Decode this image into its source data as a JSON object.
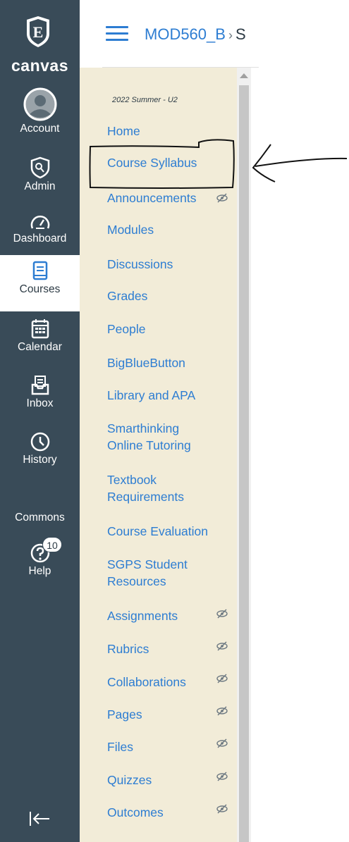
{
  "global_nav": {
    "logo_text": "canvas",
    "logo_letter": "E",
    "items": [
      {
        "label": "Account",
        "icon": "user-avatar-icon"
      },
      {
        "label": "Admin",
        "icon": "shield-icon"
      },
      {
        "label": "Dashboard",
        "icon": "speedometer-icon"
      },
      {
        "label": "Courses",
        "icon": "book-icon",
        "active": true
      },
      {
        "label": "Calendar",
        "icon": "calendar-icon"
      },
      {
        "label": "Inbox",
        "icon": "inbox-icon"
      },
      {
        "label": "History",
        "icon": "clock-icon"
      },
      {
        "label": "Commons",
        "icon": ""
      },
      {
        "label": "Help",
        "icon": "help-icon",
        "badge": "10"
      }
    ],
    "collapse_icon": "collapse-arrow-icon"
  },
  "header": {
    "course_code": "MOD560_B",
    "separator": "›",
    "next_crumb": "S"
  },
  "course_nav": {
    "term": "2022 Summer - U2",
    "items": [
      {
        "label": "Home"
      },
      {
        "label": "Course Syllabus"
      },
      {
        "label": "Announcements",
        "hidden": true
      },
      {
        "label": "Modules"
      },
      {
        "label": "Discussions"
      },
      {
        "label": "Grades"
      },
      {
        "label": "People"
      },
      {
        "label": "BigBlueButton"
      },
      {
        "label": "Library and APA"
      },
      {
        "label": "Smarthinking",
        "label2": "Online Tutoring"
      },
      {
        "label": "Textbook",
        "label2": "Requirements"
      },
      {
        "label": "Course Evaluation"
      },
      {
        "label": "SGPS Student",
        "label2": "Resources"
      },
      {
        "label": "Assignments",
        "hidden": true
      },
      {
        "label": "Rubrics",
        "hidden": true
      },
      {
        "label": "Collaborations",
        "hidden": true
      },
      {
        "label": "Pages",
        "hidden": true
      },
      {
        "label": "Files",
        "hidden": true
      },
      {
        "label": "Quizzes",
        "hidden": true
      },
      {
        "label": "Outcomes",
        "hidden": true
      }
    ]
  },
  "colors": {
    "nav_bg": "#394b58",
    "course_nav_bg": "#f2ecd8",
    "link": "#2d7dd2"
  }
}
